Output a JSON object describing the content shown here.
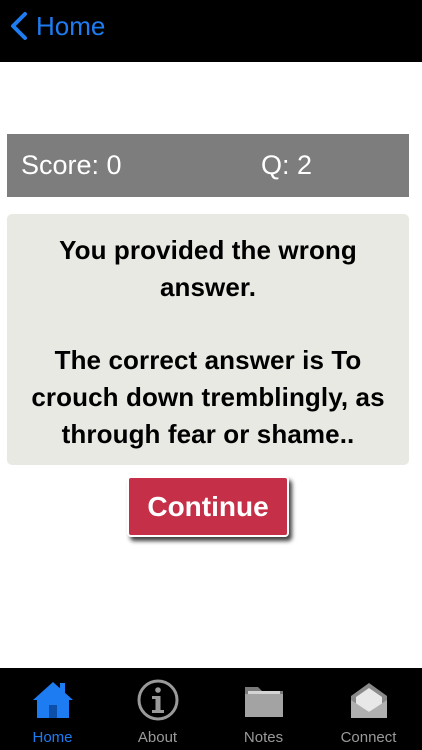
{
  "navbar": {
    "back_label": "Home"
  },
  "score_bar": {
    "score": "Score: 0",
    "question": "Q: 2"
  },
  "message": {
    "line1": "You provided the wrong",
    "line2": "answer.",
    "line3": "The correct answer is To",
    "line4": "crouch down tremblingly, as",
    "line5": "through fear or shame.."
  },
  "continue_button": {
    "label": "Continue"
  },
  "tabs": [
    {
      "label": "Home",
      "icon": "home-icon",
      "active": true
    },
    {
      "label": "About",
      "icon": "info-icon",
      "active": false
    },
    {
      "label": "Notes",
      "icon": "folder-icon",
      "active": false
    },
    {
      "label": "Connect",
      "icon": "envelope-icon",
      "active": false
    }
  ],
  "colors": {
    "accent": "#1e7cf2",
    "continue": "#c53048",
    "score_bar": "#7d7d7d",
    "card": "#e9e9e3",
    "inactive_tab": "#9a9a9a"
  }
}
